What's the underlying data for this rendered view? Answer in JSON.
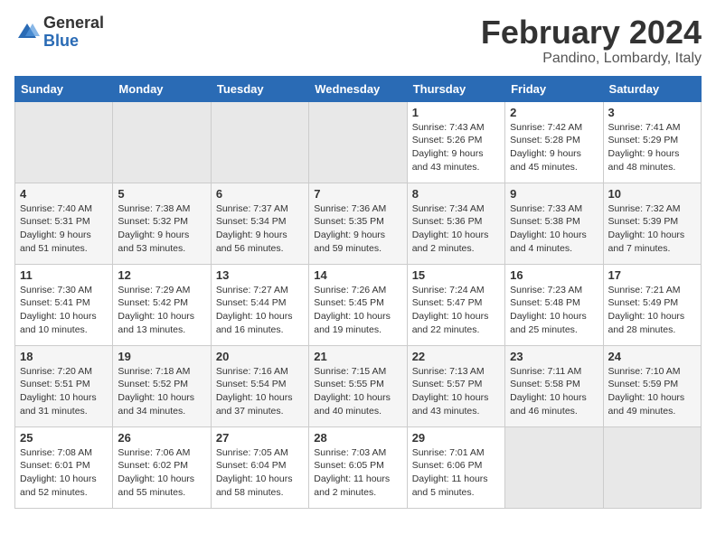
{
  "header": {
    "logo_general": "General",
    "logo_blue": "Blue",
    "month_title": "February 2024",
    "location": "Pandino, Lombardy, Italy"
  },
  "calendar": {
    "days_of_week": [
      "Sunday",
      "Monday",
      "Tuesday",
      "Wednesday",
      "Thursday",
      "Friday",
      "Saturday"
    ],
    "weeks": [
      {
        "days": [
          {
            "num": "",
            "info": ""
          },
          {
            "num": "",
            "info": ""
          },
          {
            "num": "",
            "info": ""
          },
          {
            "num": "",
            "info": ""
          },
          {
            "num": "1",
            "info": "Sunrise: 7:43 AM\nSunset: 5:26 PM\nDaylight: 9 hours\nand 43 minutes."
          },
          {
            "num": "2",
            "info": "Sunrise: 7:42 AM\nSunset: 5:28 PM\nDaylight: 9 hours\nand 45 minutes."
          },
          {
            "num": "3",
            "info": "Sunrise: 7:41 AM\nSunset: 5:29 PM\nDaylight: 9 hours\nand 48 minutes."
          }
        ]
      },
      {
        "days": [
          {
            "num": "4",
            "info": "Sunrise: 7:40 AM\nSunset: 5:31 PM\nDaylight: 9 hours\nand 51 minutes."
          },
          {
            "num": "5",
            "info": "Sunrise: 7:38 AM\nSunset: 5:32 PM\nDaylight: 9 hours\nand 53 minutes."
          },
          {
            "num": "6",
            "info": "Sunrise: 7:37 AM\nSunset: 5:34 PM\nDaylight: 9 hours\nand 56 minutes."
          },
          {
            "num": "7",
            "info": "Sunrise: 7:36 AM\nSunset: 5:35 PM\nDaylight: 9 hours\nand 59 minutes."
          },
          {
            "num": "8",
            "info": "Sunrise: 7:34 AM\nSunset: 5:36 PM\nDaylight: 10 hours\nand 2 minutes."
          },
          {
            "num": "9",
            "info": "Sunrise: 7:33 AM\nSunset: 5:38 PM\nDaylight: 10 hours\nand 4 minutes."
          },
          {
            "num": "10",
            "info": "Sunrise: 7:32 AM\nSunset: 5:39 PM\nDaylight: 10 hours\nand 7 minutes."
          }
        ]
      },
      {
        "days": [
          {
            "num": "11",
            "info": "Sunrise: 7:30 AM\nSunset: 5:41 PM\nDaylight: 10 hours\nand 10 minutes."
          },
          {
            "num": "12",
            "info": "Sunrise: 7:29 AM\nSunset: 5:42 PM\nDaylight: 10 hours\nand 13 minutes."
          },
          {
            "num": "13",
            "info": "Sunrise: 7:27 AM\nSunset: 5:44 PM\nDaylight: 10 hours\nand 16 minutes."
          },
          {
            "num": "14",
            "info": "Sunrise: 7:26 AM\nSunset: 5:45 PM\nDaylight: 10 hours\nand 19 minutes."
          },
          {
            "num": "15",
            "info": "Sunrise: 7:24 AM\nSunset: 5:47 PM\nDaylight: 10 hours\nand 22 minutes."
          },
          {
            "num": "16",
            "info": "Sunrise: 7:23 AM\nSunset: 5:48 PM\nDaylight: 10 hours\nand 25 minutes."
          },
          {
            "num": "17",
            "info": "Sunrise: 7:21 AM\nSunset: 5:49 PM\nDaylight: 10 hours\nand 28 minutes."
          }
        ]
      },
      {
        "days": [
          {
            "num": "18",
            "info": "Sunrise: 7:20 AM\nSunset: 5:51 PM\nDaylight: 10 hours\nand 31 minutes."
          },
          {
            "num": "19",
            "info": "Sunrise: 7:18 AM\nSunset: 5:52 PM\nDaylight: 10 hours\nand 34 minutes."
          },
          {
            "num": "20",
            "info": "Sunrise: 7:16 AM\nSunset: 5:54 PM\nDaylight: 10 hours\nand 37 minutes."
          },
          {
            "num": "21",
            "info": "Sunrise: 7:15 AM\nSunset: 5:55 PM\nDaylight: 10 hours\nand 40 minutes."
          },
          {
            "num": "22",
            "info": "Sunrise: 7:13 AM\nSunset: 5:57 PM\nDaylight: 10 hours\nand 43 minutes."
          },
          {
            "num": "23",
            "info": "Sunrise: 7:11 AM\nSunset: 5:58 PM\nDaylight: 10 hours\nand 46 minutes."
          },
          {
            "num": "24",
            "info": "Sunrise: 7:10 AM\nSunset: 5:59 PM\nDaylight: 10 hours\nand 49 minutes."
          }
        ]
      },
      {
        "days": [
          {
            "num": "25",
            "info": "Sunrise: 7:08 AM\nSunset: 6:01 PM\nDaylight: 10 hours\nand 52 minutes."
          },
          {
            "num": "26",
            "info": "Sunrise: 7:06 AM\nSunset: 6:02 PM\nDaylight: 10 hours\nand 55 minutes."
          },
          {
            "num": "27",
            "info": "Sunrise: 7:05 AM\nSunset: 6:04 PM\nDaylight: 10 hours\nand 58 minutes."
          },
          {
            "num": "28",
            "info": "Sunrise: 7:03 AM\nSunset: 6:05 PM\nDaylight: 11 hours\nand 2 minutes."
          },
          {
            "num": "29",
            "info": "Sunrise: 7:01 AM\nSunset: 6:06 PM\nDaylight: 11 hours\nand 5 minutes."
          },
          {
            "num": "",
            "info": ""
          },
          {
            "num": "",
            "info": ""
          }
        ]
      }
    ]
  }
}
